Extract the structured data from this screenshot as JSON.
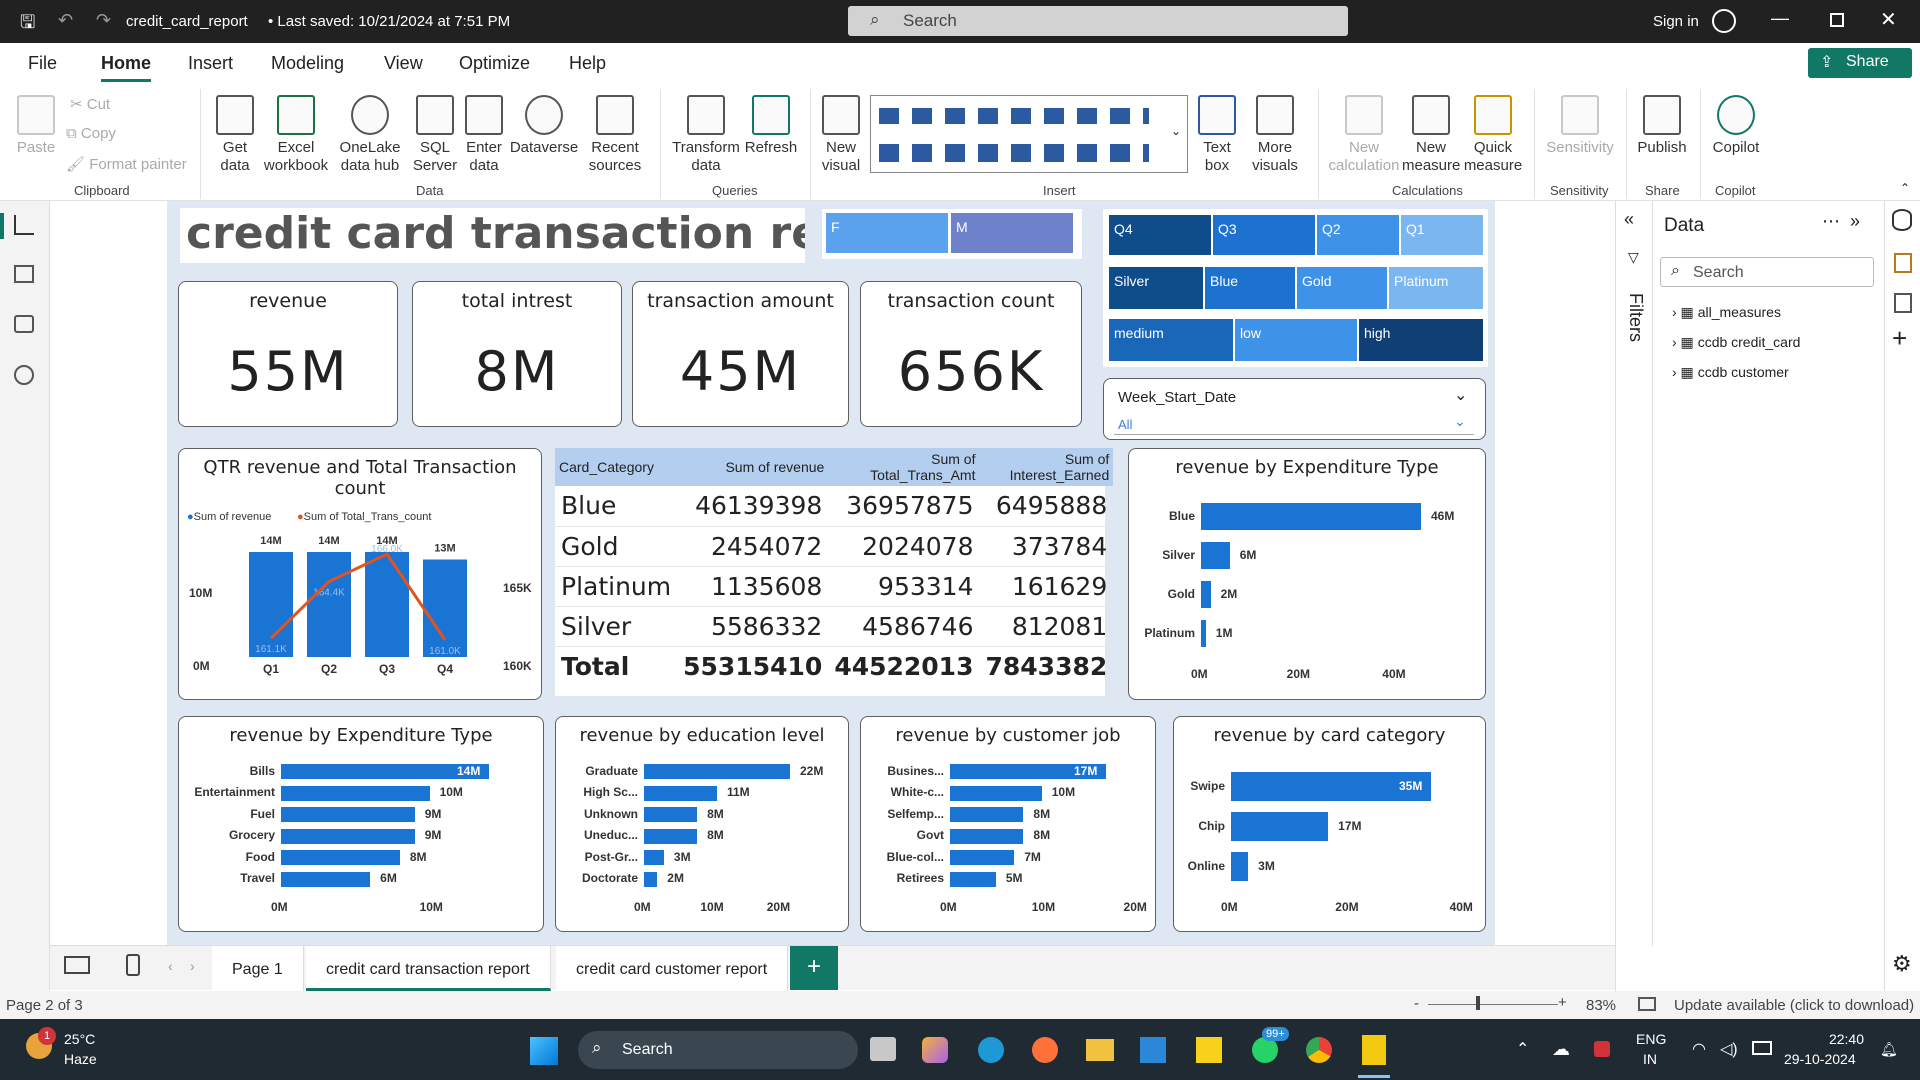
{
  "window": {
    "title": "credit_card_report",
    "saved": "• Last saved: 10/21/2024 at 7:51 PM",
    "search": "Search",
    "signin": "Sign in"
  },
  "menu": {
    "file": "File",
    "home": "Home",
    "insert": "Insert",
    "modeling": "Modeling",
    "view": "View",
    "optimize": "Optimize",
    "help": "Help",
    "share": "Share"
  },
  "ribbon": {
    "clipboard": {
      "paste": "Paste",
      "cut": "Cut",
      "copy": "Copy",
      "format": "Format painter",
      "group": "Clipboard"
    },
    "data": {
      "get": "Get data",
      "excel": "Excel workbook",
      "onelake": "OneLake data hub",
      "sql": "SQL Server",
      "enter": "Enter data",
      "dataverse": "Dataverse",
      "recent": "Recent sources",
      "group": "Data"
    },
    "queries": {
      "transform": "Transform data",
      "refresh": "Refresh",
      "group": "Queries"
    },
    "insert": {
      "newvisual": "New visual",
      "textbox": "Text box",
      "more": "More visuals",
      "group": "Insert"
    },
    "calc": {
      "newcalc": "New calculation",
      "newmeasure": "New measure",
      "quick": "Quick measure",
      "group": "Calculations"
    },
    "sens": {
      "label": "Sensitivity",
      "group": "Sensitivity"
    },
    "share": {
      "publish": "Publish",
      "group": "Share"
    },
    "copilot": {
      "label": "Copilot",
      "group": "Copilot"
    }
  },
  "report": {
    "title": "credit card transaction report",
    "slicers": {
      "gender": [
        "F",
        "M"
      ],
      "quarter": [
        "Q4",
        "Q3",
        "Q2",
        "Q1"
      ],
      "category": [
        "Silver",
        "Blue",
        "Gold",
        "Platinum"
      ],
      "income": [
        "medium",
        "low",
        "high"
      ],
      "week": {
        "label": "Week_Start_Date",
        "value": "All"
      }
    },
    "kpis": [
      {
        "label": "revenue",
        "value": "55M"
      },
      {
        "label": "total intrest",
        "value": "8M"
      },
      {
        "label": "transaction amount",
        "value": "45M"
      },
      {
        "label": "transaction count",
        "value": "656K"
      }
    ],
    "combo": {
      "title": "QTR revenue and Total Transaction count",
      "legend1": "Sum of revenue",
      "legend2": "Sum of Total_Trans_count",
      "yl_top": "10M",
      "yl_bot": "0M",
      "yr_top": "165K",
      "yr_bot": "160K"
    },
    "table": {
      "headers": [
        "Card_Category",
        "Sum of revenue",
        "Sum of Total_Trans_Amt",
        "Sum of Interest_Earned"
      ],
      "rows": [
        [
          "Blue",
          "46139398",
          "36957875",
          "6495888"
        ],
        [
          "Gold",
          "2454072",
          "2024078",
          "373784"
        ],
        [
          "Platinum",
          "1135608",
          "953314",
          "161629"
        ],
        [
          "Silver",
          "5586332",
          "4586746",
          "812081"
        ]
      ],
      "total": [
        "Total",
        "55315410",
        "44522013",
        "7843382"
      ]
    },
    "titles": {
      "exp_top": "revenue by Expenditure Type",
      "exp": "revenue by Expenditure Type",
      "edu": "revenue by education level",
      "job": "revenue by customer job",
      "cat": "revenue by card category"
    }
  },
  "chart_data": [
    {
      "type": "bar",
      "title": "QTR revenue and Total Transaction count",
      "categories": [
        "Q1",
        "Q2",
        "Q3",
        "Q4"
      ],
      "series": [
        {
          "name": "Sum of revenue",
          "values": [
            14,
            14,
            14,
            13
          ],
          "labels": [
            "14M",
            "14M",
            "14M",
            "13M"
          ]
        },
        {
          "name": "Sum of Total_Trans_count",
          "values": [
            161.1,
            164.4,
            166.0,
            161.0
          ],
          "labels": [
            "161.1K",
            "164.4K",
            "166.0K",
            "161.0K"
          ]
        }
      ],
      "ylim": [
        0,
        10
      ],
      "y2lim": [
        160,
        165
      ]
    },
    {
      "type": "bar",
      "title": "revenue by Expenditure Type",
      "categories": [
        "Blue",
        "Silver",
        "Gold",
        "Platinum"
      ],
      "values": [
        46,
        6,
        2,
        1
      ],
      "labels": [
        "46M",
        "6M",
        "2M",
        "1M"
      ],
      "ticks": [
        "0M",
        "20M",
        "40M"
      ]
    },
    {
      "type": "bar",
      "title": "revenue by Expenditure Type",
      "categories": [
        "Bills",
        "Entertainment",
        "Fuel",
        "Grocery",
        "Food",
        "Travel"
      ],
      "values": [
        14,
        10,
        9,
        9,
        8,
        6
      ],
      "labels": [
        "14M",
        "10M",
        "9M",
        "9M",
        "8M",
        "6M"
      ],
      "ticks": [
        "0M",
        "10M"
      ]
    },
    {
      "type": "bar",
      "title": "revenue by education level",
      "categories": [
        "Graduate",
        "High Sc...",
        "Unknown",
        "Uneduc...",
        "Post-Gr...",
        "Doctorate"
      ],
      "values": [
        22,
        11,
        8,
        8,
        3,
        2
      ],
      "labels": [
        "22M",
        "11M",
        "8M",
        "8M",
        "3M",
        "2M"
      ],
      "ticks": [
        "0M",
        "10M",
        "20M"
      ]
    },
    {
      "type": "bar",
      "title": "revenue by customer job",
      "categories": [
        "Busines...",
        "White-c...",
        "Selfemp...",
        "Govt",
        "Blue-col...",
        "Retirees"
      ],
      "values": [
        17,
        10,
        8,
        8,
        7,
        5
      ],
      "labels": [
        "17M",
        "10M",
        "8M",
        "8M",
        "7M",
        "5M"
      ],
      "ticks": [
        "0M",
        "10M",
        "20M"
      ]
    },
    {
      "type": "bar",
      "title": "revenue by card category",
      "categories": [
        "Swipe",
        "Chip",
        "Online"
      ],
      "values": [
        35,
        17,
        3
      ],
      "labels": [
        "35M",
        "17M",
        "3M"
      ],
      "ticks": [
        "0M",
        "20M",
        "40M"
      ]
    }
  ],
  "datapane": {
    "title": "Data",
    "filters": "Filters",
    "search": "Search",
    "items": [
      "all_measures",
      "ccdb credit_card",
      "ccdb customer"
    ]
  },
  "pages": {
    "p1": "Page 1",
    "p2": "credit card transaction report",
    "p3": "credit card customer report"
  },
  "status": {
    "page": "Page 2 of 3",
    "zoom": "83%",
    "update": "Update available (click to download)"
  },
  "taskbar": {
    "temp": "25°C",
    "weather": "Haze",
    "search": "Search",
    "lang1": "ENG",
    "lang2": "IN",
    "time": "22:40",
    "date": "29-10-2024",
    "badge": "99+"
  }
}
